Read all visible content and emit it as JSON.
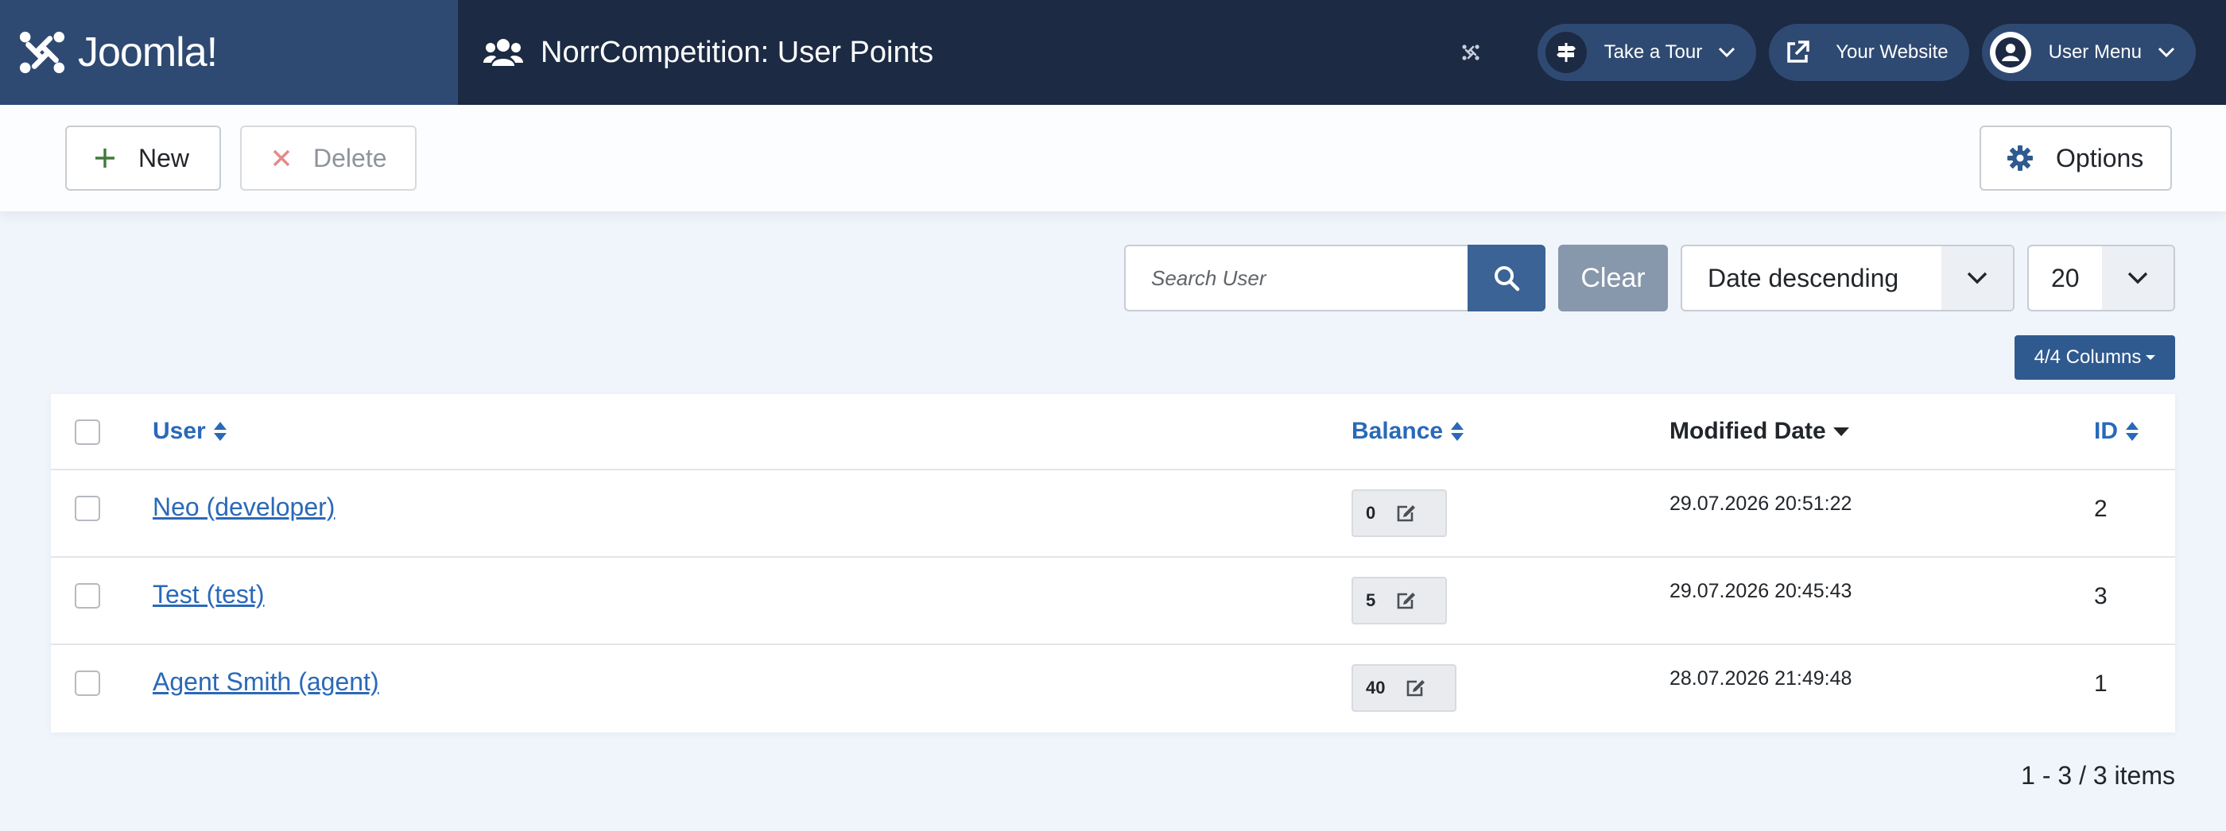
{
  "header": {
    "logo_text": "Joomla!",
    "page_title": "NorrCompetition: User Points",
    "page_icon": "users-icon",
    "buttons": [
      {
        "label": "Take a Tour",
        "icon": "signpost-icon"
      },
      {
        "label": "Your Website",
        "icon": "external-link-icon"
      },
      {
        "label": "User Menu",
        "icon": "user-circle-icon"
      }
    ]
  },
  "toolbar": {
    "new_label": "New",
    "delete_label": "Delete",
    "options_label": "Options"
  },
  "filters": {
    "search_placeholder": "Search User",
    "search_value": "",
    "clear_label": "Clear",
    "ordering_value": "Date descending",
    "limit_value": "20",
    "columns_label": "4/4 Columns"
  },
  "table": {
    "columns": {
      "user": "User",
      "balance": "Balance",
      "modified": "Modified Date",
      "id": "ID"
    },
    "rows": [
      {
        "user": "Neo (developer)",
        "balance": "0",
        "modified": "29.07.2026 20:51:22",
        "id": "2"
      },
      {
        "user": "Test (test)",
        "balance": "5",
        "modified": "29.07.2026 20:45:43",
        "id": "3"
      },
      {
        "user": "Agent Smith (agent)",
        "balance": "40",
        "modified": "28.07.2026 21:49:48",
        "id": "1"
      }
    ]
  },
  "pagination": {
    "summary": "1 - 3 / 3 items"
  },
  "colors": {
    "header_bg": "#1c2a43",
    "logo_bg": "#2f4a72",
    "link": "#2a69b8",
    "primary": "#3b6395"
  }
}
